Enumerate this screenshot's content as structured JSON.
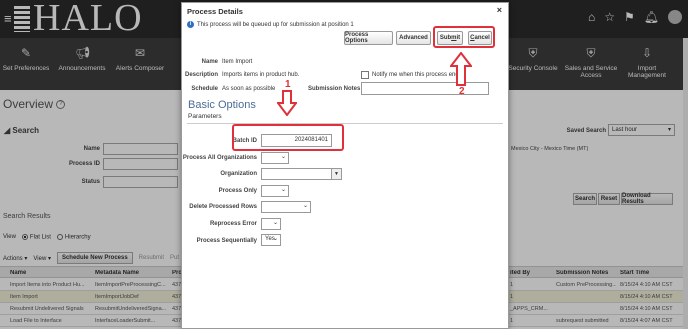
{
  "app": {
    "logo_text": "HALO",
    "nav_items": [
      {
        "label": "Set Preferences",
        "icon": "gear-user-icon"
      },
      {
        "label": "Announcements",
        "icon": "megaphone-icon"
      },
      {
        "label": "Alerts Composer",
        "icon": "bell-icon"
      },
      {
        "label": "Security Console",
        "icon": "shield-icon"
      },
      {
        "label": "Sales and Service Access",
        "icon": "shield-person-icon"
      },
      {
        "label": "Import Management",
        "icon": "import-icon"
      }
    ],
    "page_title": "Overview",
    "search_heading": "Search",
    "labels": {
      "name": "Name",
      "process_id": "Process ID",
      "status": "Status",
      "saved_search": "Saved Search",
      "timezone_text": "Mexico City - Mexico Time (MT)"
    },
    "saved_search_value": "Last hour",
    "buttons": {
      "search": "Search",
      "reset": "Reset",
      "download": "Download Results"
    },
    "search_results": "Search Results",
    "view_label": "View",
    "flat_list": "Flat List",
    "hierarchy": "Hierarchy",
    "actions": "Actions",
    "view": "View",
    "schedule_new_process": "Schedule New Process",
    "resubmit": "Resubmit",
    "put_on_hold": "Put O",
    "table": {
      "headers": [
        "Name",
        "Metadata Name",
        "Pro",
        "ited By",
        "Submission Notes",
        "Start Time"
      ],
      "rows": [
        [
          "Import Items into Product Hu...",
          "ItemImportPreProcessingC...",
          "437",
          "1",
          "Custom PreProcessing...",
          "8/15/24 4:10 AM CST"
        ],
        [
          "Item Import",
          "ItemImportJobDef",
          "437",
          "1",
          "",
          "8/15/24 4:10 AM CST"
        ],
        [
          "Resubmit Undelivered Signals",
          "ResubmitUndeliveredSigna...",
          "437",
          "_APPS_CRM...",
          "",
          "8/15/24 4:10 AM CST"
        ],
        [
          "Load File to Interface",
          "InterfaceLoaderSubmit...",
          "437",
          "1",
          "subrequest submitted",
          "8/15/24 4:07 AM CST"
        ]
      ]
    }
  },
  "dialog": {
    "title": "Process Details",
    "info_message": "This process will be queued up for submission at position 1",
    "buttons": {
      "process_options": "Process Options",
      "advanced": "Advanced",
      "submit_pre": "Sub",
      "submit_u": "m",
      "submit_post": "it",
      "cancel_pre": "",
      "cancel_u": "C",
      "cancel_post": "ancel"
    },
    "close_symbol": "×",
    "fields": {
      "name_label": "Name",
      "name_value": "Item Import",
      "description_label": "Description",
      "description_value": "Imports items in product hub.",
      "notify_label": "Notify me when this process ends",
      "schedule_label": "Schedule",
      "schedule_value": "As soon as possible",
      "submission_notes_label": "Submission Notes",
      "submission_notes_value": ""
    },
    "basic_options": "Basic Options",
    "parameters": "Parameters",
    "params": {
      "batch_id_label": "Batch ID",
      "batch_id_value": "2024081401",
      "process_all_orgs_label": "Process All Organizations",
      "organization_label": "Organization",
      "process_only_label": "Process Only",
      "delete_processed_rows_label": "Delete Processed Rows",
      "reprocess_error_label": "Reprocess Error",
      "process_sequentially_label": "Process Sequentially",
      "process_sequentially_value": "Yes"
    }
  },
  "annotations": {
    "step1": "1",
    "step2": "2",
    "color": "#e0313a"
  }
}
